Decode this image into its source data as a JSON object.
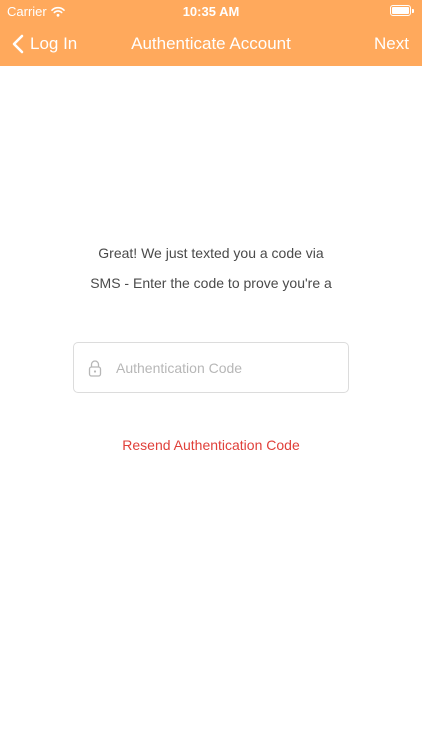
{
  "status_bar": {
    "carrier": "Carrier",
    "time": "10:35 AM",
    "wifi_icon": "wifi-icon",
    "battery_icon": "battery-icon",
    "battery_level": 1.0
  },
  "nav_bar": {
    "back_label": "Log In",
    "back_icon": "chevron-left-icon",
    "title": "Authenticate Account",
    "next_label": "Next",
    "background_color": "#ffa95c"
  },
  "message": {
    "line1": "Great! We just texted you a code via",
    "line2": "SMS - Enter the code to prove you're a"
  },
  "auth_code": {
    "placeholder": "Authentication Code",
    "value": "",
    "icon": "lock-icon"
  },
  "resend": {
    "label": "Resend Authentication Code",
    "color": "#e0403a"
  }
}
